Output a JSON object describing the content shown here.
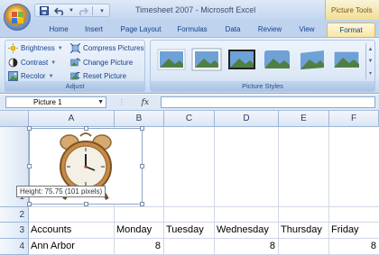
{
  "window": {
    "title": "Timesheet 2007 - Microsoft Excel",
    "context_tab_group": "Picture Tools"
  },
  "quick_access": {
    "items": [
      "save-icon",
      "undo-icon",
      "redo-icon",
      "customize-icon"
    ]
  },
  "tabs": [
    {
      "label": "Home"
    },
    {
      "label": "Insert"
    },
    {
      "label": "Page Layout"
    },
    {
      "label": "Formulas"
    },
    {
      "label": "Data"
    },
    {
      "label": "Review"
    },
    {
      "label": "View"
    },
    {
      "label": "Format",
      "active": true
    }
  ],
  "ribbon": {
    "adjust": {
      "label": "Adjust",
      "brightness": "Brightness",
      "contrast": "Contrast",
      "recolor": "Recolor",
      "compress": "Compress Pictures",
      "change": "Change Picture",
      "reset": "Reset Picture"
    },
    "styles": {
      "label": "Picture Styles",
      "thumb_count": 6
    }
  },
  "formula_bar": {
    "name_box": "Picture 1",
    "fx": "fx",
    "formula": ""
  },
  "grid": {
    "columns": [
      "A",
      "B",
      "C",
      "D",
      "E",
      "F"
    ],
    "rows": [
      "1",
      "2",
      "3",
      "4"
    ],
    "cells": {
      "a3": "Accounts",
      "b3": "Monday",
      "c3": "Tuesday",
      "d3": "Wednesday",
      "e3": "Thursday",
      "f3": "Friday",
      "a4": "Ann Arbor",
      "b4": "8",
      "d4": "8",
      "f4": "8"
    }
  },
  "picture": {
    "tooltip": "Height: 75.75 (101 pixels)",
    "subject": "alarm-clock"
  },
  "colors": {
    "ribbon": "#dde8f6",
    "accent": "#15428b",
    "context_tab": "#f2dd93"
  }
}
